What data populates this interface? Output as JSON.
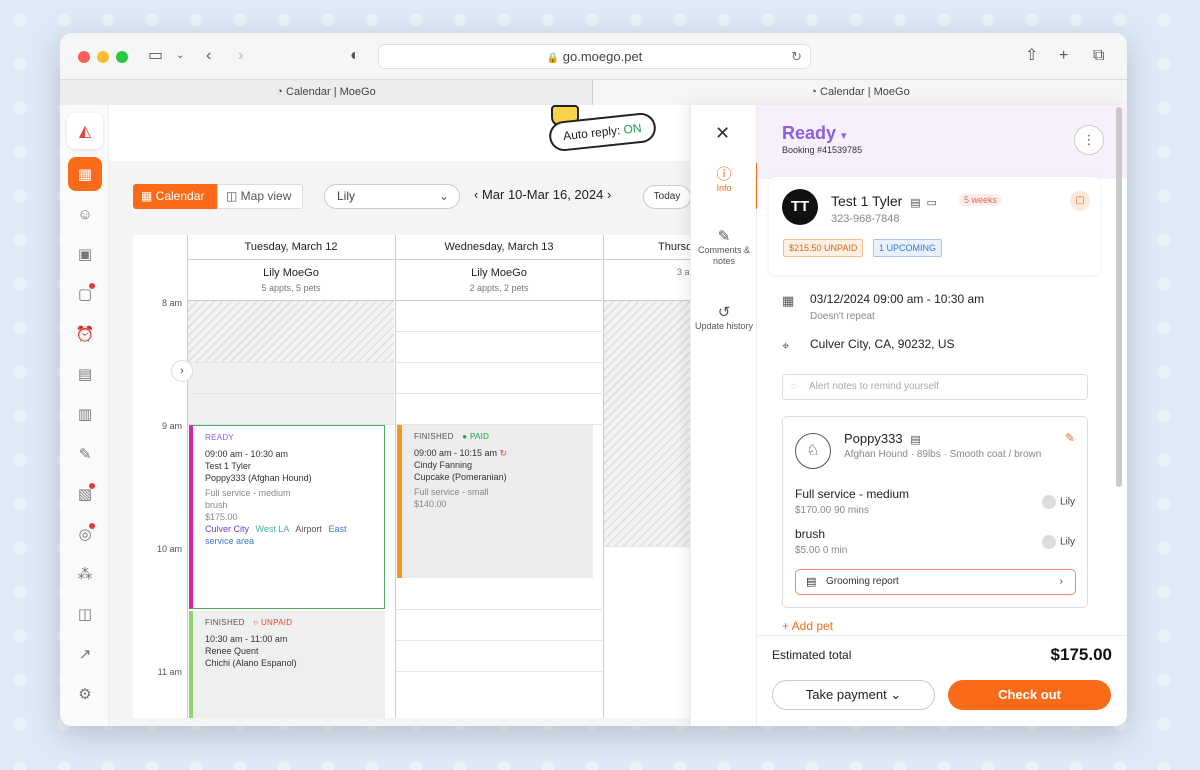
{
  "browser": {
    "url": "go.moego.pet",
    "tabs": [
      "Calendar | MoeGo",
      "Calendar | MoeGo"
    ]
  },
  "topbar": {
    "auto_reply_label": "Auto reply:",
    "auto_reply_state": "ON"
  },
  "toolbar": {
    "calendar_label": "Calendar",
    "map_label": "Map view",
    "staff_selected": "Lily",
    "date_range": "Mar 10-Mar 16, 2024",
    "today_label": "Today"
  },
  "calendar": {
    "times": [
      "8 am",
      "9 am",
      "10 am",
      "11 am"
    ],
    "days": [
      {
        "title": "Tuesday, March 12",
        "staff": "Lily MoeGo",
        "summary": "5 appts, 5 pets"
      },
      {
        "title": "Wednesday, March 13",
        "staff": "Lily MoeGo",
        "summary": "2 appts, 2 pets"
      },
      {
        "title": "Thursd",
        "staff": "",
        "summary": "3 a"
      }
    ],
    "appointments": [
      {
        "status": "READY",
        "time": "09:00 am - 10:30 am",
        "client": "Test 1 Tyler",
        "pet": "Poppy333",
        "breed": "(Afghan Hound)",
        "service": "Full service - medium",
        "addon": "brush",
        "price": "$175.00",
        "areas": [
          "Culver City",
          "West LA",
          "Airport",
          "East service area"
        ]
      },
      {
        "status": "FINISHED",
        "pay": "PAID",
        "time": "09:00 am - 10:15 am",
        "client": "Cindy Fanning",
        "pet": "Cupcake",
        "breed": "(Pomeranian)",
        "service": "Full service - small",
        "price": "$140.00"
      },
      {
        "status": "FINISHED",
        "pay": "UNPAID",
        "time": "10:30 am - 11:00 am",
        "client": "Renee Quent",
        "pet": "Chichi",
        "breed": "(Alano Espanol)"
      }
    ]
  },
  "drawer": {
    "nav": [
      {
        "label": "Info"
      },
      {
        "label": "Comments & notes"
      },
      {
        "label": "Update history"
      }
    ],
    "status": "Ready",
    "booking": "Booking #41539785",
    "client": {
      "initials": "TT",
      "name": "Test 1 Tyler",
      "phone": "323-968-7848",
      "frequency": "5 weeks",
      "unpaid": "$215.50 UNPAID",
      "upcoming": "1 UPCOMING"
    },
    "datetime": "03/12/2024  09:00 am - 10:30 am",
    "repeat": "Doesn't repeat",
    "address": "Culver City, CA, 90232, US",
    "notes_placeholder": "Alert notes to remind yourself",
    "pet": {
      "name": "Poppy333",
      "desc": "Afghan Hound · 89lbs · Smooth coat / brown",
      "services": [
        {
          "name": "Full service - medium",
          "price": "$170.00",
          "duration": "90 mins",
          "staff": "Lily"
        },
        {
          "name": "brush",
          "price": "$5.00",
          "duration": "0 min",
          "staff": "Lily"
        }
      ],
      "report_label": "Grooming report"
    },
    "add_pet": "+ Add pet",
    "estimated_label": "Estimated total",
    "estimated_value": "$175.00",
    "take_payment": "Take payment",
    "checkout": "Check out"
  },
  "colors": {
    "accent": "#f96b18",
    "ready": "#8e5ee0",
    "paid": "#1ea04a",
    "unpaid": "#e0462f"
  }
}
